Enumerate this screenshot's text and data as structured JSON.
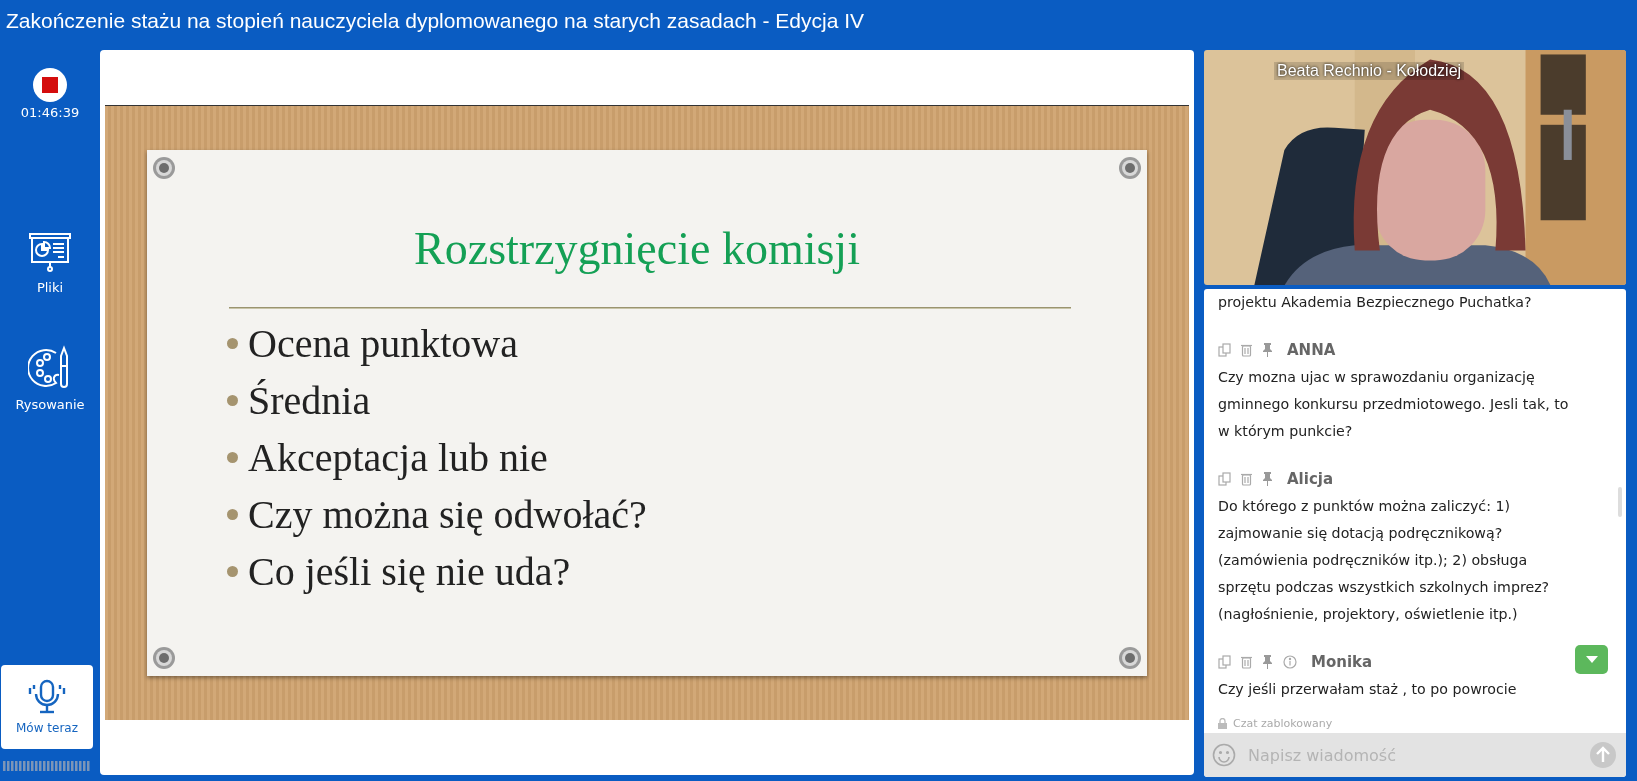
{
  "window": {
    "title": "Zakończenie stażu na stopień nauczyciela dyplomowanego na starych zasadach - Edycja IV"
  },
  "sidebar": {
    "recording": {
      "on": true,
      "time": "01:46:39"
    },
    "items": [
      {
        "kind": "files",
        "label": "Pliki"
      },
      {
        "kind": "drawing",
        "label": "Rysowanie"
      }
    ],
    "speak_button": {
      "label": "Mów teraz"
    }
  },
  "slide": {
    "title": "Rozstrzygnięcie komisji",
    "bullets": [
      "Ocena punktowa",
      "Średnia",
      "Akceptacja lub nie",
      "Czy można się odwołać?",
      "Co jeśli się nie uda?"
    ]
  },
  "video": {
    "name": "Beata Rechnio - Kołodziej"
  },
  "chat": {
    "top_fragment": "projektu Akademia Bezpiecznego Puchatka?",
    "messages": [
      {
        "author": "ANNA",
        "info": false,
        "text": "Czy mozna ujac w sprawozdaniu organizację gminnego konkursu przedmiotowego. Jesli tak, to w którym punkcie?"
      },
      {
        "author": "Alicja",
        "info": false,
        "text": "Do którego z punktów można zaliczyć: 1) zajmowanie się dotacją podręcznikową? (zamówienia podręczników itp.); 2) obsługa sprzętu podczas wszystkich szkolnych imprez? (nagłośnienie, projektory, oświetlenie itp.)"
      },
      {
        "author": "Monika",
        "info": true,
        "text": "Czy jeśli przerwałam staż , to po powrocie"
      }
    ],
    "locked": true,
    "locked_label": "Czat zablokowany",
    "input": {
      "placeholder": "Napisz wiadomość"
    }
  }
}
